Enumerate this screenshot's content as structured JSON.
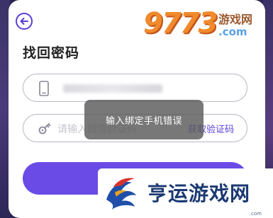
{
  "page": {
    "title": "找回密码"
  },
  "form": {
    "code_placeholder": "请输入短信验证码",
    "get_code_label": "获取验证码"
  },
  "toast": {
    "message": "输入绑定手机错误"
  },
  "watermark": {
    "number": "9773",
    "text": "游戏网",
    "domain": ".com"
  },
  "site_logo": {
    "text": "亨运游戏网",
    "domain": ".com"
  },
  "colors": {
    "accent": "#6a4be6",
    "link": "#5b3fd6",
    "background": "#2a2450"
  },
  "icons": {
    "back": "back-arrow-icon",
    "phone": "phone-icon",
    "key": "key-icon"
  }
}
